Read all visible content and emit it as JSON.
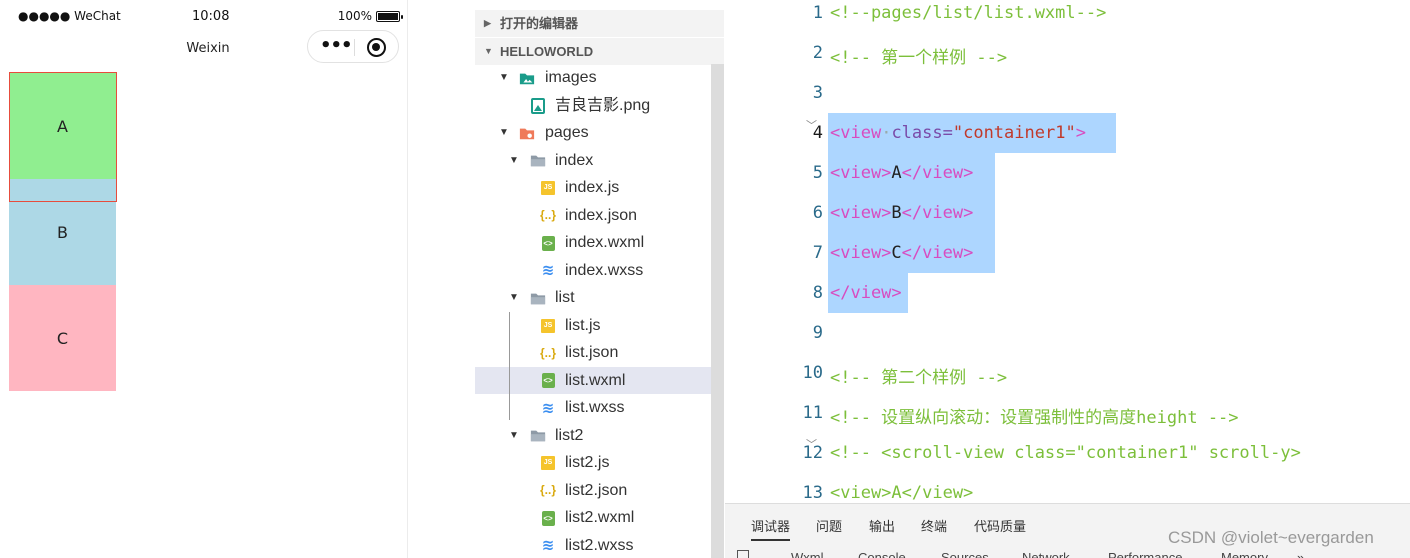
{
  "phone": {
    "status_left": "●●●●● WeChat",
    "status_time": "10:08",
    "battery_text": "100%",
    "nav_title": "Weixin",
    "capsule_more": "•••",
    "boxes": [
      {
        "label": "A",
        "color": "#90ee90"
      },
      {
        "label": "B",
        "color": "#add8e6"
      },
      {
        "label": "C",
        "color": "#ffb6c1"
      }
    ]
  },
  "explorer": {
    "open_editors": "打开的编辑器",
    "project": "HELLOWORLD",
    "items": [
      {
        "label": "images",
        "icon": "image-folder-icon",
        "twisty": "▼"
      },
      {
        "label": "吉良吉影.png",
        "icon": "png-file-icon"
      },
      {
        "label": "pages",
        "icon": "pages-folder-icon",
        "twisty": "▼"
      },
      {
        "label": "index",
        "icon": "folder-open-icon",
        "twisty": "▼"
      },
      {
        "label": "index.js",
        "icon": "js-file-icon"
      },
      {
        "label": "index.json",
        "icon": "json-file-icon"
      },
      {
        "label": "index.wxml",
        "icon": "wxml-file-icon"
      },
      {
        "label": "index.wxss",
        "icon": "wxss-file-icon"
      },
      {
        "label": "list",
        "icon": "folder-open-icon",
        "twisty": "▼"
      },
      {
        "label": "list.js",
        "icon": "js-file-icon"
      },
      {
        "label": "list.json",
        "icon": "json-file-icon"
      },
      {
        "label": "list.wxml",
        "icon": "wxml-file-icon",
        "selected": true
      },
      {
        "label": "list.wxss",
        "icon": "wxss-file-icon"
      },
      {
        "label": "list2",
        "icon": "folder-open-icon",
        "twisty": "▼"
      },
      {
        "label": "list2.js",
        "icon": "js-file-icon"
      },
      {
        "label": "list2.json",
        "icon": "json-file-icon"
      },
      {
        "label": "list2.wxml",
        "icon": "wxml-file-icon"
      },
      {
        "label": "list2.wxss",
        "icon": "wxss-file-icon"
      }
    ]
  },
  "editor": {
    "line_numbers": [
      "1",
      "2",
      "3",
      "4",
      "5",
      "6",
      "7",
      "8",
      "9",
      "10",
      "11",
      "12",
      "13"
    ],
    "lines": {
      "l1": "<!--pages/list/list.wxml-->",
      "l2": "<!-- 第一个样例 -->",
      "l4_open": "<view",
      "l4_space": "·",
      "l4_attr": "class=",
      "l4_str": "\"container1\"",
      "l4_close": ">",
      "l5_open": "<view>",
      "l5_text": "A",
      "l5_close": "</view>",
      "l6_open": "<view>",
      "l6_text": "B",
      "l6_close": "</view>",
      "l7_open": "<view>",
      "l7_text": "C",
      "l7_close": "</view>",
      "l8": "</view>",
      "l10": "<!-- 第二个样例 -->",
      "l11": "<!-- 设置纵向滚动：设置强制性的高度height -->",
      "l12": "<!-- <scroll-view class=\"container1\" scroll-y>",
      "l13": "<view>A</view>"
    }
  },
  "panel": {
    "tabs": [
      "调试器",
      "问题",
      "输出",
      "终端",
      "代码质量"
    ],
    "subtabs": [
      "Wxml",
      "Console",
      "Sources",
      "Network",
      "Performance",
      "Memory",
      "»"
    ]
  },
  "watermark": "CSDN @violet~evergarden",
  "colors": {
    "selection": "#add6ff",
    "comment": "#7cbf3a",
    "tag": "#d84cc0",
    "string": "#c0392b"
  }
}
